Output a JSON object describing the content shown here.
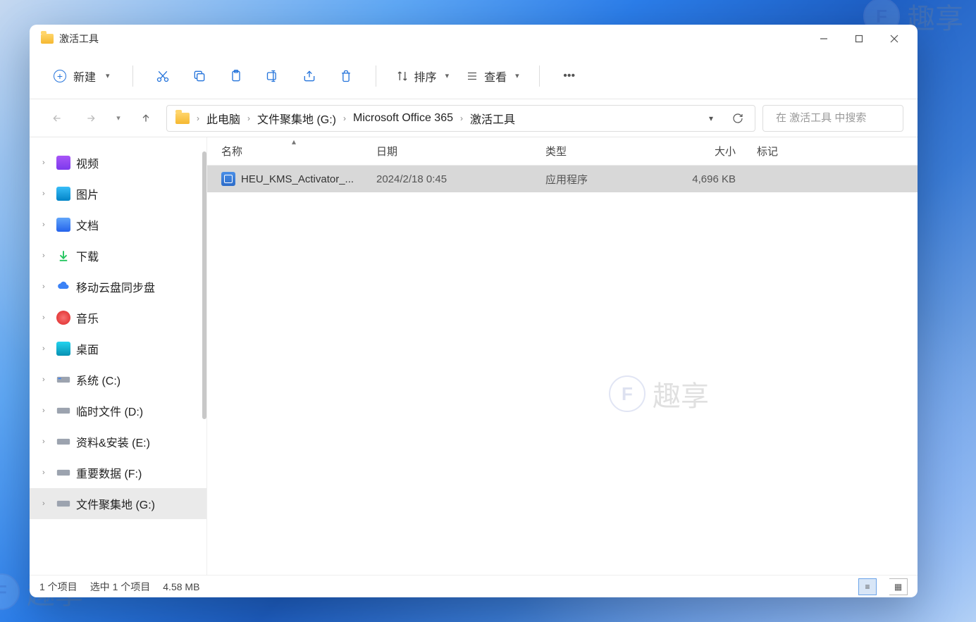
{
  "window": {
    "title": "激活工具"
  },
  "toolbar": {
    "new_label": "新建",
    "sort_label": "排序",
    "view_label": "查看"
  },
  "breadcrumbs": {
    "b0": "此电脑",
    "b1": "文件聚集地 (G:)",
    "b2": "Microsoft Office 365",
    "b3": "激活工具"
  },
  "search": {
    "placeholder": "在 激活工具 中搜索"
  },
  "columns": {
    "name": "名称",
    "date": "日期",
    "type": "类型",
    "size": "大小",
    "tag": "标记"
  },
  "sidebar": {
    "items": [
      {
        "label": "视频"
      },
      {
        "label": "图片"
      },
      {
        "label": "文档"
      },
      {
        "label": "下载"
      },
      {
        "label": "移动云盘同步盘"
      },
      {
        "label": "音乐"
      },
      {
        "label": "桌面"
      },
      {
        "label": "系统 (C:)"
      },
      {
        "label": "临时文件 (D:)"
      },
      {
        "label": "资料&安装 (E:)"
      },
      {
        "label": "重要数据 (F:)"
      },
      {
        "label": "文件聚集地 (G:)"
      }
    ]
  },
  "files": {
    "row0": {
      "name": "HEU_KMS_Activator_...",
      "date": "2024/2/18 0:45",
      "type": "应用程序",
      "size": "4,696 KB"
    }
  },
  "status": {
    "count": "1 个项目",
    "selected": "选中 1 个项目",
    "size": "4.58 MB"
  },
  "watermark": {
    "letter": "F",
    "text": "趣享"
  }
}
